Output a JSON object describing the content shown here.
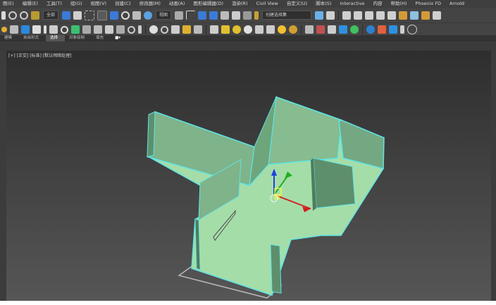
{
  "menubar": {
    "items": [
      "图(E)",
      "编辑(E)",
      "工具(T)",
      "组(G)",
      "视图(V)",
      "创建(C)",
      "修改器(M)",
      "动画(A)",
      "图形编辑器(D)",
      "渲染(R)",
      "Civil View",
      "自定义(U)",
      "脚本(S)",
      "Interactive",
      "内容",
      "帮助(H)",
      "Phoenix FD",
      "Arnold"
    ]
  },
  "toolbar": {
    "selection_filter": "全部",
    "reference_coord": "视图",
    "named_selection": "创建选择集"
  },
  "ribbon": {
    "tabs": [
      "建模",
      "自由形式",
      "选择",
      "对象绘制",
      "填充"
    ],
    "active_tab": "选择"
  },
  "viewport": {
    "label": "[+] [正交] [标准] [默认明暗处理]"
  },
  "colors": {
    "floor": "#a5dda9",
    "wall_face": "#7fb38a",
    "wall_shadow": "#5d8f6c",
    "outline": "#5ee5e5",
    "gizmo_x": "#d02020",
    "gizmo_y": "#20b020",
    "gizmo_z": "#2040e0",
    "gizmo_center": "#ffff40"
  }
}
